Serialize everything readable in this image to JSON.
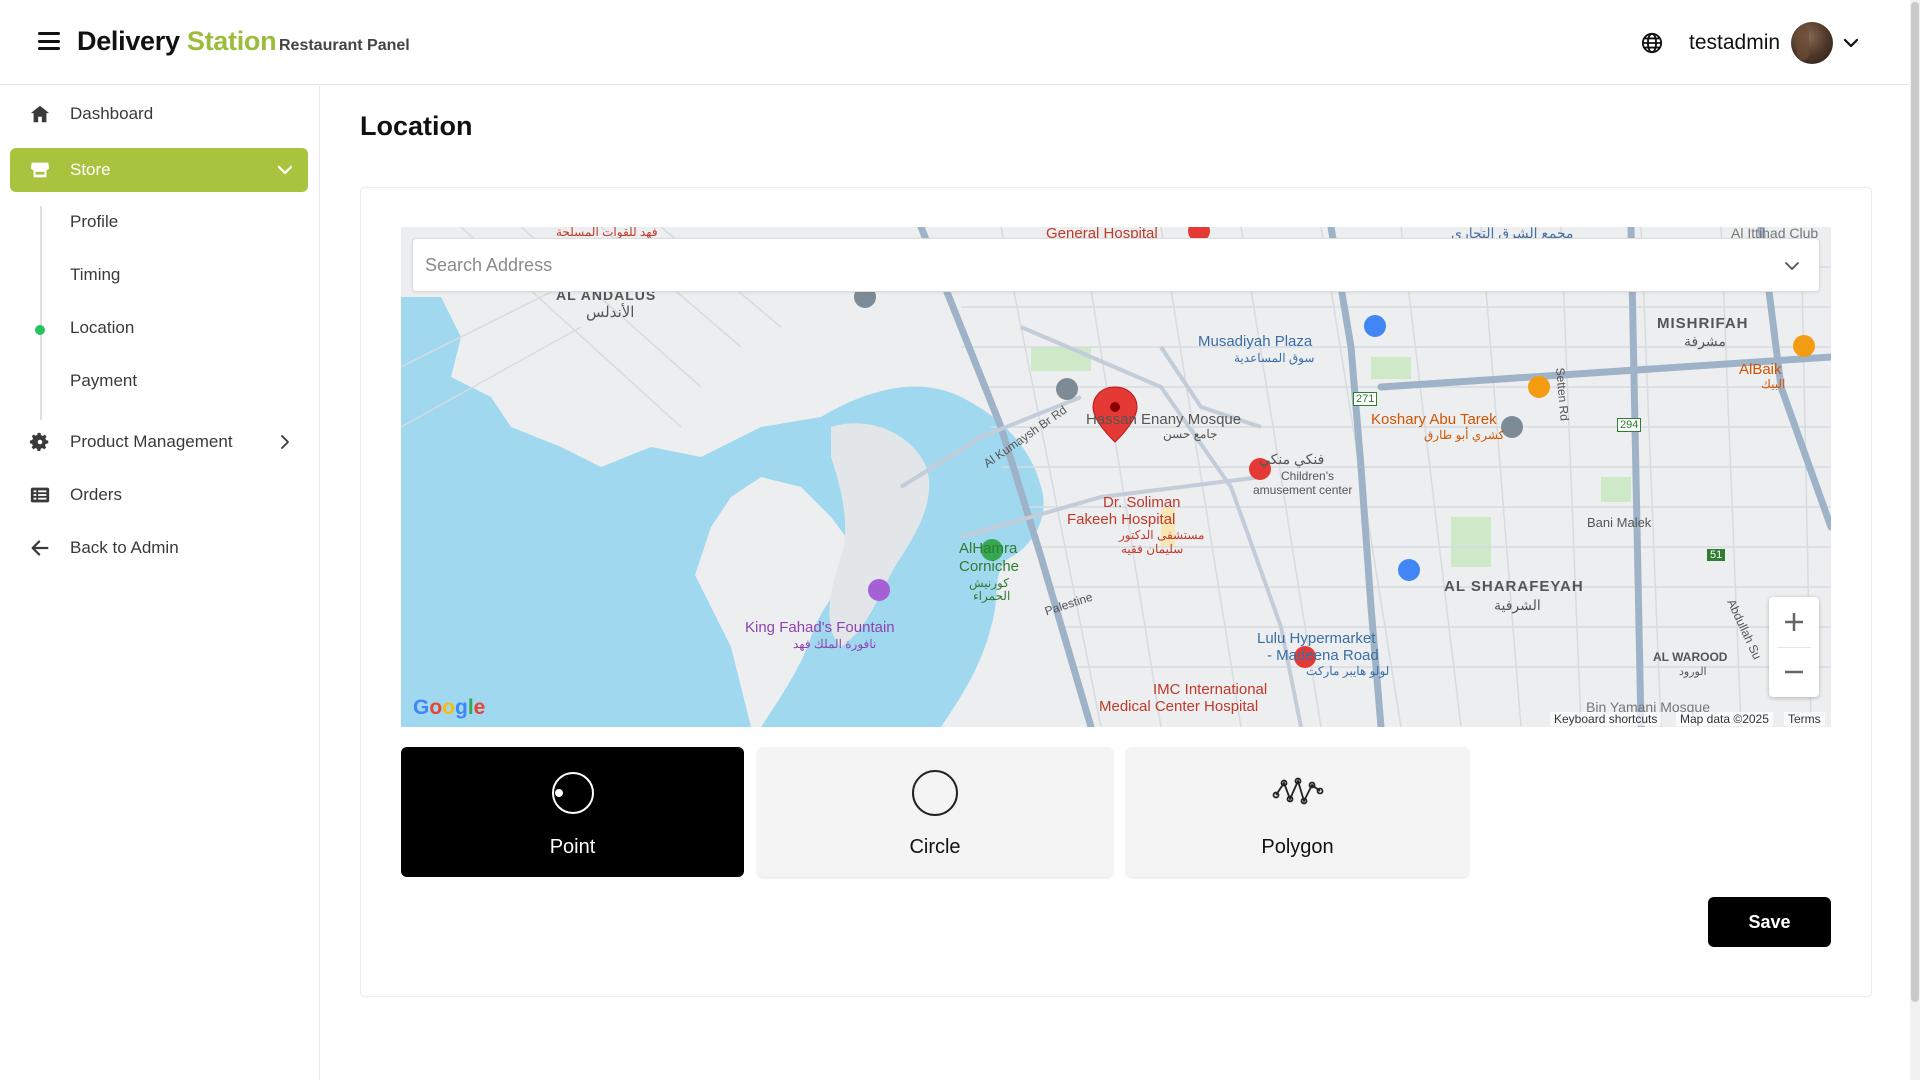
{
  "header": {
    "brand_primary": "Delivery",
    "brand_secondary": "Station",
    "brand_sub": "Restaurant Panel",
    "username": "testadmin"
  },
  "sidebar": {
    "items": [
      {
        "label": "Dashboard",
        "icon": "home-icon"
      },
      {
        "label": "Store",
        "icon": "store-icon",
        "active": true
      },
      {
        "label": "Product Management",
        "icon": "gear-icon"
      },
      {
        "label": "Orders",
        "icon": "list-icon"
      },
      {
        "label": "Back to Admin",
        "icon": "arrow-left-icon"
      }
    ],
    "store_subitems": [
      "Profile",
      "Timing",
      "Location",
      "Payment"
    ],
    "active_subitem": "Location"
  },
  "main": {
    "title": "Location",
    "search": {
      "placeholder": "Search Address",
      "value": ""
    },
    "map_labels": {
      "al_andalus": "AL ANDALUS",
      "al_andalus_ar": "الأندلس",
      "mishrifah": "MISHRIFAH",
      "mishrifah_ar": "مشرفة",
      "musadiyah": "Musadiyah Plaza",
      "musadiyah_ar": "سوق المساعدية",
      "hassan": "Hassan Enany Mosque",
      "hassan_ar": "جامع حسن",
      "koshary": "Koshary Abu Tarek",
      "koshary_ar": "كشري أبو طارق",
      "albaik": "AlBaik",
      "albaik_ar": "البيك",
      "children1": "فنكي منكي",
      "children2": "Children's",
      "children3": "amusement center",
      "soliman1": "Dr. Soliman",
      "soliman2": "Fakeeh Hospital",
      "soliman_ar1": "مستشفى الدكتور",
      "soliman_ar2": "سليمان فقيه",
      "alhamra1": "AlHamra",
      "alhamra2": "Corniche",
      "alhamra_ar1": "كورنيش",
      "alhamra_ar2": "الحمراء",
      "kumaysh": "Al Kumaysh Br Rd",
      "palestine": "Palestine",
      "fountain": "King Fahad's Fountain",
      "fountain_ar": "نافورة الملك فهد",
      "lulu1": "Lulu Hypermarket",
      "lulu2": "- Madeena Road",
      "lulu_ar": "لولو هايبر ماركت",
      "imc1": "IMC International",
      "imc2": "Medical Center Hospital",
      "sharafeyah": "AL SHARAFEYAH",
      "sharafeyah_ar": "الشرفية",
      "bani_malek": "Bani Malek",
      "al_warood": "AL WAROOD",
      "al_warood_ar": "الورود",
      "general_hospital": "General Hospital",
      "settenrd": "Setten Rd",
      "r271": "271",
      "r294": "294",
      "r51": "51",
      "bin_yamani": "Bin Yamani Mosque",
      "abdullah": "Abdullah Su",
      "alittihad": "Al Ittihad Club",
      "top_ar1": "فهد للقوات المسلحة",
      "top_ar2": "مجمع الشرق التجاري"
    },
    "attribution": {
      "google": "Google",
      "shortcuts": "Keyboard shortcuts",
      "mapdata": "Map data ©2025",
      "terms": "Terms"
    },
    "shapes": [
      {
        "label": "Point",
        "icon": "point-icon",
        "selected": true
      },
      {
        "label": "Circle",
        "icon": "circle-icon",
        "selected": false
      },
      {
        "label": "Polygon",
        "icon": "polygon-icon",
        "selected": false
      }
    ],
    "save_label": "Save"
  },
  "colors": {
    "brand_accent": "#9bbd3c",
    "active_nav": "#a8c43e",
    "water": "#9fd8ef",
    "pin": "#e53935"
  }
}
